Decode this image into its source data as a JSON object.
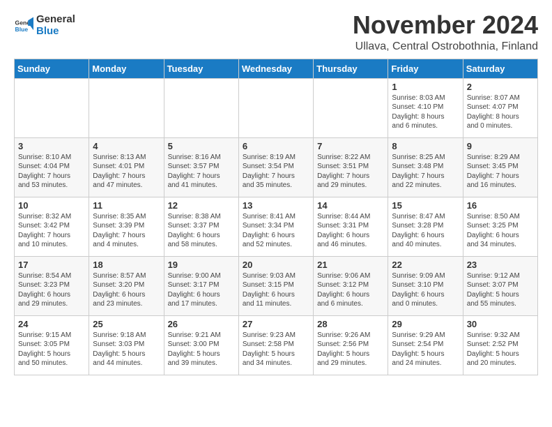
{
  "logo": {
    "line1": "General",
    "line2": "Blue"
  },
  "title": "November 2024",
  "location": "Ullava, Central Ostrobothnia, Finland",
  "weekdays": [
    "Sunday",
    "Monday",
    "Tuesday",
    "Wednesday",
    "Thursday",
    "Friday",
    "Saturday"
  ],
  "weeks": [
    [
      {
        "day": "",
        "info": ""
      },
      {
        "day": "",
        "info": ""
      },
      {
        "day": "",
        "info": ""
      },
      {
        "day": "",
        "info": ""
      },
      {
        "day": "",
        "info": ""
      },
      {
        "day": "1",
        "info": "Sunrise: 8:03 AM\nSunset: 4:10 PM\nDaylight: 8 hours\nand 6 minutes."
      },
      {
        "day": "2",
        "info": "Sunrise: 8:07 AM\nSunset: 4:07 PM\nDaylight: 8 hours\nand 0 minutes."
      }
    ],
    [
      {
        "day": "3",
        "info": "Sunrise: 8:10 AM\nSunset: 4:04 PM\nDaylight: 7 hours\nand 53 minutes."
      },
      {
        "day": "4",
        "info": "Sunrise: 8:13 AM\nSunset: 4:01 PM\nDaylight: 7 hours\nand 47 minutes."
      },
      {
        "day": "5",
        "info": "Sunrise: 8:16 AM\nSunset: 3:57 PM\nDaylight: 7 hours\nand 41 minutes."
      },
      {
        "day": "6",
        "info": "Sunrise: 8:19 AM\nSunset: 3:54 PM\nDaylight: 7 hours\nand 35 minutes."
      },
      {
        "day": "7",
        "info": "Sunrise: 8:22 AM\nSunset: 3:51 PM\nDaylight: 7 hours\nand 29 minutes."
      },
      {
        "day": "8",
        "info": "Sunrise: 8:25 AM\nSunset: 3:48 PM\nDaylight: 7 hours\nand 22 minutes."
      },
      {
        "day": "9",
        "info": "Sunrise: 8:29 AM\nSunset: 3:45 PM\nDaylight: 7 hours\nand 16 minutes."
      }
    ],
    [
      {
        "day": "10",
        "info": "Sunrise: 8:32 AM\nSunset: 3:42 PM\nDaylight: 7 hours\nand 10 minutes."
      },
      {
        "day": "11",
        "info": "Sunrise: 8:35 AM\nSunset: 3:39 PM\nDaylight: 7 hours\nand 4 minutes."
      },
      {
        "day": "12",
        "info": "Sunrise: 8:38 AM\nSunset: 3:37 PM\nDaylight: 6 hours\nand 58 minutes."
      },
      {
        "day": "13",
        "info": "Sunrise: 8:41 AM\nSunset: 3:34 PM\nDaylight: 6 hours\nand 52 minutes."
      },
      {
        "day": "14",
        "info": "Sunrise: 8:44 AM\nSunset: 3:31 PM\nDaylight: 6 hours\nand 46 minutes."
      },
      {
        "day": "15",
        "info": "Sunrise: 8:47 AM\nSunset: 3:28 PM\nDaylight: 6 hours\nand 40 minutes."
      },
      {
        "day": "16",
        "info": "Sunrise: 8:50 AM\nSunset: 3:25 PM\nDaylight: 6 hours\nand 34 minutes."
      }
    ],
    [
      {
        "day": "17",
        "info": "Sunrise: 8:54 AM\nSunset: 3:23 PM\nDaylight: 6 hours\nand 29 minutes."
      },
      {
        "day": "18",
        "info": "Sunrise: 8:57 AM\nSunset: 3:20 PM\nDaylight: 6 hours\nand 23 minutes."
      },
      {
        "day": "19",
        "info": "Sunrise: 9:00 AM\nSunset: 3:17 PM\nDaylight: 6 hours\nand 17 minutes."
      },
      {
        "day": "20",
        "info": "Sunrise: 9:03 AM\nSunset: 3:15 PM\nDaylight: 6 hours\nand 11 minutes."
      },
      {
        "day": "21",
        "info": "Sunrise: 9:06 AM\nSunset: 3:12 PM\nDaylight: 6 hours\nand 6 minutes."
      },
      {
        "day": "22",
        "info": "Sunrise: 9:09 AM\nSunset: 3:10 PM\nDaylight: 6 hours\nand 0 minutes."
      },
      {
        "day": "23",
        "info": "Sunrise: 9:12 AM\nSunset: 3:07 PM\nDaylight: 5 hours\nand 55 minutes."
      }
    ],
    [
      {
        "day": "24",
        "info": "Sunrise: 9:15 AM\nSunset: 3:05 PM\nDaylight: 5 hours\nand 50 minutes."
      },
      {
        "day": "25",
        "info": "Sunrise: 9:18 AM\nSunset: 3:03 PM\nDaylight: 5 hours\nand 44 minutes."
      },
      {
        "day": "26",
        "info": "Sunrise: 9:21 AM\nSunset: 3:00 PM\nDaylight: 5 hours\nand 39 minutes."
      },
      {
        "day": "27",
        "info": "Sunrise: 9:23 AM\nSunset: 2:58 PM\nDaylight: 5 hours\nand 34 minutes."
      },
      {
        "day": "28",
        "info": "Sunrise: 9:26 AM\nSunset: 2:56 PM\nDaylight: 5 hours\nand 29 minutes."
      },
      {
        "day": "29",
        "info": "Sunrise: 9:29 AM\nSunset: 2:54 PM\nDaylight: 5 hours\nand 24 minutes."
      },
      {
        "day": "30",
        "info": "Sunrise: 9:32 AM\nSunset: 2:52 PM\nDaylight: 5 hours\nand 20 minutes."
      }
    ]
  ]
}
